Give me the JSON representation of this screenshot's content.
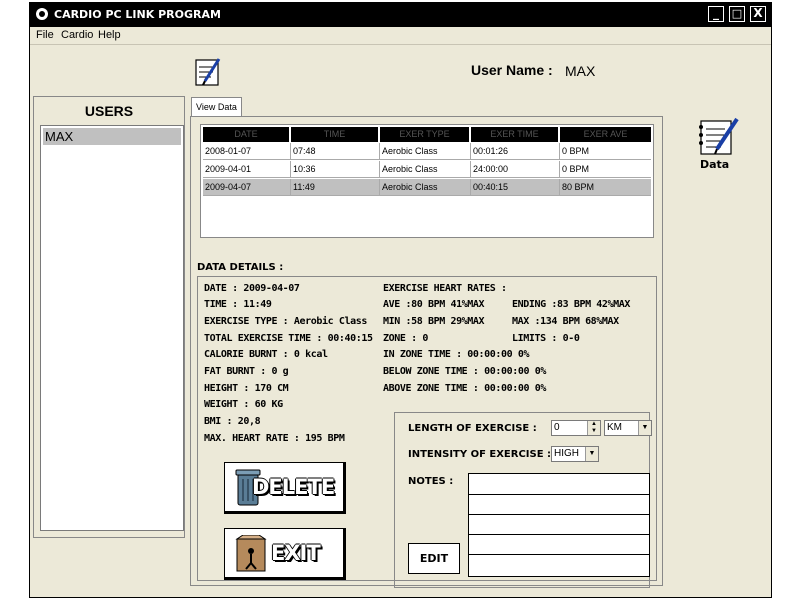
{
  "window": {
    "title": "CARDIO PC LINK PROGRAM"
  },
  "titlebar_buttons": {
    "minimize": "_",
    "maximize": "□",
    "close": "X"
  },
  "menu": [
    "File",
    "Cardio",
    "Help"
  ],
  "header": {
    "username_label": "User Name :",
    "username_value": "MAX"
  },
  "users": {
    "title": "USERS",
    "items": [
      "MAX"
    ],
    "selected": "MAX"
  },
  "tabs": [
    "View Data"
  ],
  "grid": {
    "columns": [
      "DATE",
      "TIME",
      "EXER TYPE",
      "EXER TIME",
      "EXER AVE"
    ],
    "rows": [
      [
        "2008-01-07",
        "07:48",
        "Aerobic Class",
        "00:01:26",
        "0 BPM"
      ],
      [
        "2009-04-01",
        "10:36",
        "Aerobic Class",
        "24:00:00",
        "0 BPM"
      ],
      [
        "2009-04-07",
        "11:49",
        "Aerobic Class",
        "00:40:15",
        "80 BPM"
      ]
    ],
    "selected_row": 2
  },
  "details": {
    "title": "DATA DETAILS :",
    "date": "DATE :    2009-04-07",
    "time": "TIME :     11:49",
    "exercise_type": "EXERCISE TYPE :    Aerobic Class",
    "total_time": "TOTAL EXERCISE TIME : 00:40:15",
    "calorie": "CALORIE BURNT : 0 kcal",
    "fat": "FAT BURNT :   0 g",
    "height": "HEIGHT :    170 CM",
    "weight": "WEIGHT :    60 KG",
    "bmi": "BMI :          20,8",
    "max_hr": "MAX. HEART RATE :  195 BPM",
    "hr_title": "EXERCISE HEART RATES :",
    "ave": "AVE :80 BPM 41%MAX",
    "ending": "ENDING :83 BPM 42%MAX",
    "min": "MIN :58 BPM 29%MAX",
    "max": "MAX :134 BPM 68%MAX",
    "zone": "ZONE : 0",
    "limits": "LIMITS : 0-0",
    "in_zone": "IN ZONE TIME : 00:00:00  0%",
    "below_zone": "BELOW ZONE TIME : 00:00:00  0%",
    "above_zone": "ABOVE ZONE TIME : 00:00:00  0%"
  },
  "form": {
    "length_label": "LENGTH OF EXERCISE :",
    "length_value": "0",
    "unit_value": "KM",
    "intensity_label": "INTENSITY OF EXERCISE :",
    "intensity_value": "HIGH",
    "notes_label": "NOTES :",
    "edit_label": "EDIT"
  },
  "buttons": {
    "delete": "DELETE",
    "exit": "EXIT"
  },
  "right_panel": {
    "data_label": "Data"
  }
}
